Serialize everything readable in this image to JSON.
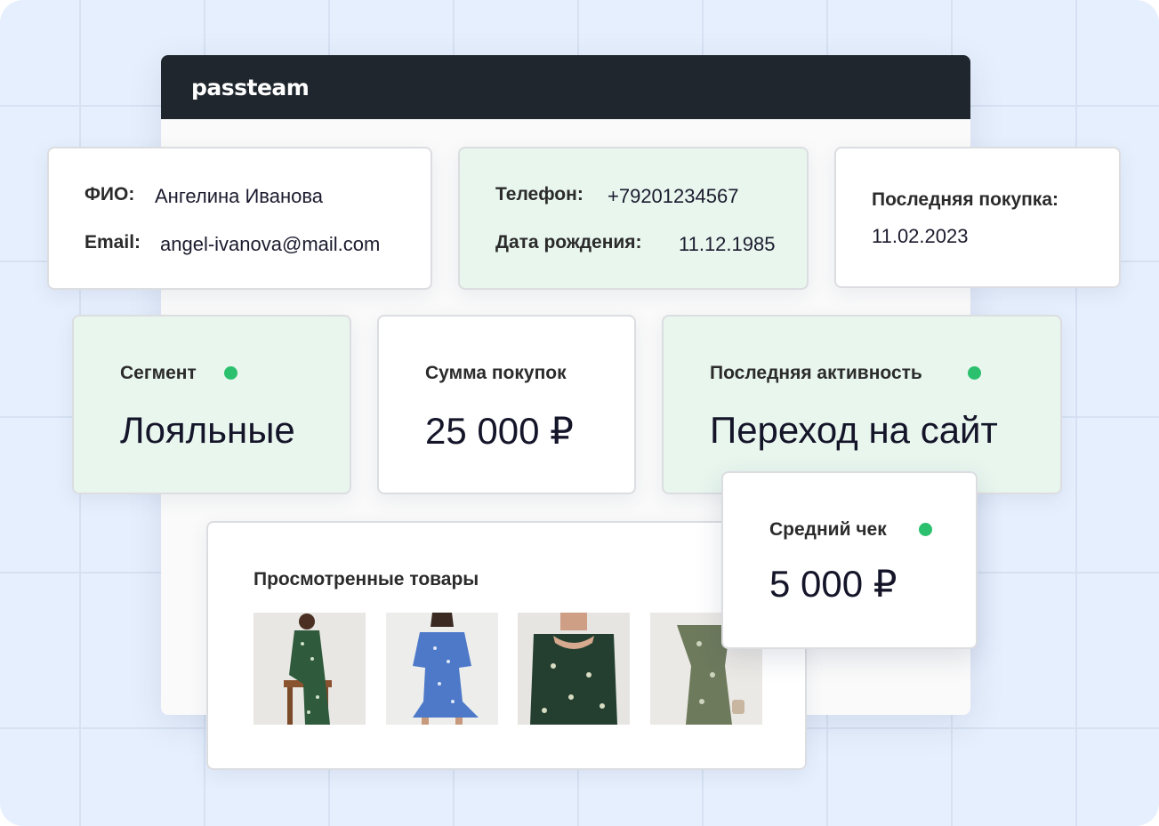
{
  "app": {
    "logo": "passteam"
  },
  "contact": {
    "name_label": "ФИО:",
    "name_value": "Ангелина Иванова",
    "email_label": "Email:",
    "email_value": "angel-ivanova@mail.com"
  },
  "personal": {
    "phone_label": "Телефон:",
    "phone_value": "+79201234567",
    "birth_label": "Дата рождения:",
    "birth_value": "11.12.1985"
  },
  "last_purchase": {
    "label": "Последняя покупка:",
    "value": "11.02.2023"
  },
  "segment": {
    "label": "Сегмент",
    "value": "Лояльные",
    "status_color": "#2bc06e"
  },
  "purchases_sum": {
    "label": "Сумма покупок",
    "value": "25 000 ₽"
  },
  "last_activity": {
    "label": "Последняя активность",
    "value": "Переход на сайт",
    "status_color": "#2bc06e"
  },
  "average_check": {
    "label": "Средний чек",
    "value": "5 000 ₽",
    "status_color": "#2bc06e"
  },
  "viewed_products": {
    "title": "Просмотренные товары",
    "items": [
      {
        "icon": "green-floral-dress-image"
      },
      {
        "icon": "blue-floral-dress-image"
      },
      {
        "icon": "dark-green-floral-dress-image"
      },
      {
        "icon": "sage-floral-slip-dress-image"
      }
    ]
  },
  "colors": {
    "header_bg": "#1f262e",
    "green_card_bg": "#e8f6ee",
    "status_green": "#2bc06e",
    "background": "#e6effd"
  }
}
